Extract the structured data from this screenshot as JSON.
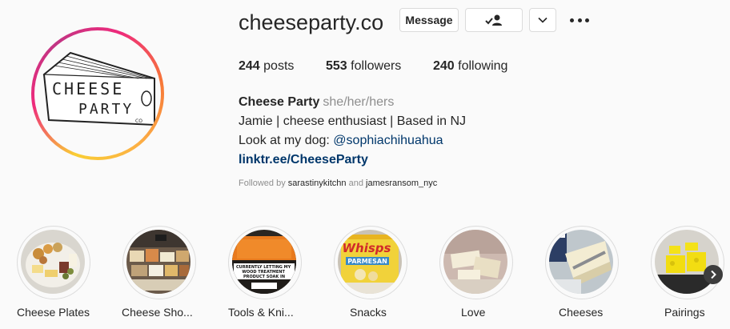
{
  "profile": {
    "username": "cheeseparty.co",
    "avatar_lettering": [
      "CHEESE",
      "PARTY",
      "CO"
    ]
  },
  "actions": {
    "message_label": "Message",
    "follow_icon": "person-check-icon",
    "dropdown_icon": "chevron-down-icon",
    "more_icon": "more-horizontal-icon"
  },
  "stats": {
    "posts_count": "244",
    "posts_label": "posts",
    "followers_count": "553",
    "followers_label": "followers",
    "following_count": "240",
    "following_label": "following"
  },
  "bio": {
    "name": "Cheese Party",
    "pronouns": "she/her/hers",
    "line1": "Jamie | cheese enthusiast | Based in NJ",
    "line2_prefix": "Look at my dog: ",
    "line2_mention": "@sophiachihuahua",
    "link": "linktr.ee/CheeseParty"
  },
  "followed_by": {
    "prefix": "Followed by",
    "user1": "sarastinykitchn",
    "and": "and",
    "user2": "jamesransom_nyc"
  },
  "highlights": [
    {
      "label": "Cheese Plates"
    },
    {
      "label": "Cheese Sho..."
    },
    {
      "label": "Tools & Kni..."
    },
    {
      "label": "Snacks"
    },
    {
      "label": "Love"
    },
    {
      "label": "Cheeses"
    },
    {
      "label": "Pairings"
    }
  ],
  "highlight_texts": {
    "tools_overlay": "CURRENTLY LETTING MY WOOD TREATMENT PRODUCT SOAK IN",
    "snacks_brand": "Whisps",
    "snacks_sub": "PARMESAN"
  },
  "carousel": {
    "next_icon": "chevron-right-icon"
  },
  "colors": {
    "text": "#262626",
    "secondary": "#8e8e8e",
    "link": "#00376b",
    "border": "#dbdbdb",
    "story_ring_start": "#f9ce34",
    "story_ring_mid": "#ee2a7b",
    "story_ring_end": "#c13584"
  }
}
